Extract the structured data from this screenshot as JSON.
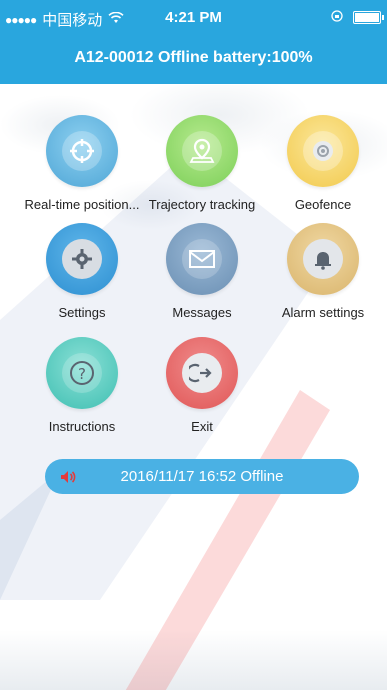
{
  "status_bar": {
    "carrier": "中国移动",
    "time": "4:21 PM"
  },
  "header": {
    "title": "A12-00012 Offline battery:100%"
  },
  "menu": {
    "realtime": "Real-time position...",
    "trajectory": "Trajectory tracking",
    "geofence": "Geofence",
    "settings": "Settings",
    "messages": "Messages",
    "alarm": "Alarm settings",
    "instructions": "Instructions",
    "exit": "Exit"
  },
  "status_message": "2016/11/17 16:52 Offline",
  "icons": {
    "realtime": "crosshair-icon",
    "trajectory": "map-pin-icon",
    "geofence": "geofence-icon",
    "settings": "gear-icon",
    "messages": "envelope-icon",
    "alarm": "bell-icon",
    "instructions": "question-icon",
    "exit": "exit-icon",
    "speaker": "speaker-icon"
  },
  "colors": {
    "header": "#29a6de",
    "realtime": "#4fa6d6",
    "trajectory": "#7ccf58",
    "geofence": "#f2c94c",
    "settings": "#2d8fd1",
    "messages": "#6a8fb3",
    "alarm": "#d9b46b",
    "instructions": "#3fbfb2",
    "exit": "#e05656"
  }
}
